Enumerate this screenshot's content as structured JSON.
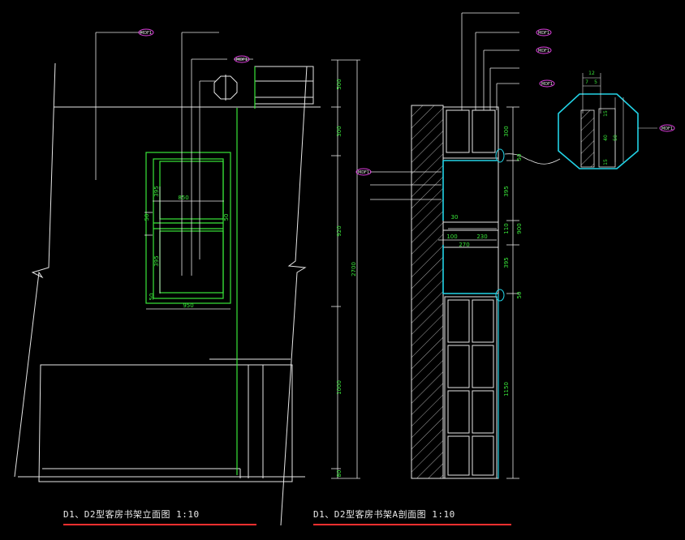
{
  "titles": {
    "elevation": "D1、D2型客房书架立面图  1:10",
    "section": "D1、D2型客房书架A剖面图  1:10"
  },
  "tags": {
    "code": "MDF1"
  },
  "dims": {
    "elev_width_outer": "950",
    "elev_width_inner": "850",
    "elev_h_top": "395",
    "elev_h_bot": "395",
    "elev_side": "50",
    "elev_side2": "50",
    "elev_bottom": "50",
    "wall_500": "500",
    "wall_300": "300",
    "wall_920": "920",
    "wall_2700": "2700",
    "wall_1000": "1000",
    "wall_80": "80",
    "sec_300": "300",
    "sec_50a": "50",
    "sec_395a": "395",
    "sec_900": "900",
    "sec_395b": "395",
    "sec_50b": "50",
    "sec_110": "110",
    "sec_1150": "1150",
    "sec_30": "30",
    "sec_100": "100",
    "sec_230": "230",
    "sec_270": "270",
    "det_12": "12",
    "det_7": "7",
    "det_5": "5",
    "det_15a": "15",
    "det_40": "40",
    "det_50": "50",
    "det_15b": "15"
  }
}
